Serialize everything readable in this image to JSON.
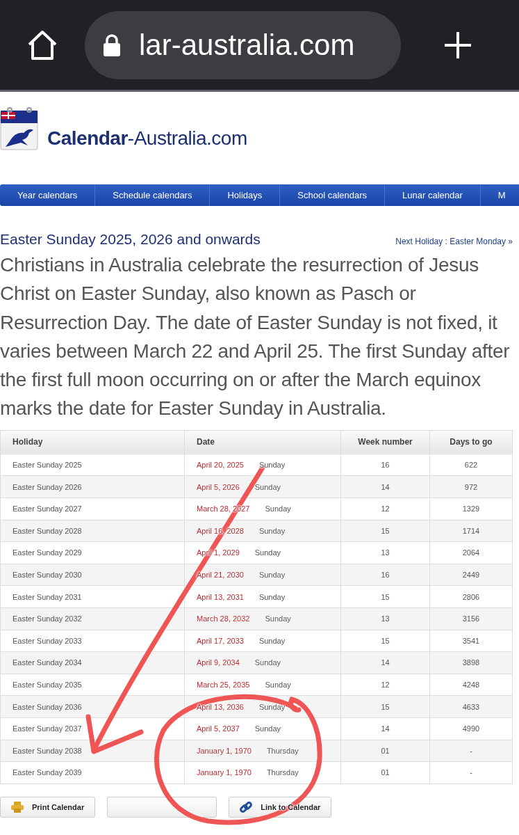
{
  "browser": {
    "url": "lar-australia.com"
  },
  "site": {
    "logo_text": "**Calendar**-Australia.com"
  },
  "nav": [
    {
      "label": "Year calendars"
    },
    {
      "label": "Schedule calendars"
    },
    {
      "label": "Holidays"
    },
    {
      "label": "School calendars"
    },
    {
      "label": "Lunar calendar"
    },
    {
      "label": "M"
    }
  ],
  "page": {
    "title": "Easter Sunday 2025, 2026 and onwards",
    "next_holiday": "Next Holiday : Easter Monday »",
    "intro": "Christians in Australia celebrate the resurrection of Jesus Christ on Easter Sunday, also known as Pasch or Resurrection Day. The date of Easter Sunday is not fixed, it varies between March 22 and April 25. The first Sunday after the first full moon occurring on or after the March equinox marks the date for Easter Sunday in Australia."
  },
  "table": {
    "columns": [
      "Holiday",
      "Date",
      "Week number",
      "Days to go"
    ],
    "rows": [
      {
        "holiday": "Easter Sunday 2025",
        "date": "April 20, 2025",
        "weekday": "Sunday",
        "week": "16",
        "days": "622"
      },
      {
        "holiday": "Easter Sunday 2026",
        "date": "April 5, 2026",
        "weekday": "Sunday",
        "week": "14",
        "days": "972"
      },
      {
        "holiday": "Easter Sunday 2027",
        "date": "March 28, 2027",
        "weekday": "Sunday",
        "week": "12",
        "days": "1329"
      },
      {
        "holiday": "Easter Sunday 2028",
        "date": "April 16, 2028",
        "weekday": "Sunday",
        "week": "15",
        "days": "1714"
      },
      {
        "holiday": "Easter Sunday 2029",
        "date": "April 1, 2029",
        "weekday": "Sunday",
        "week": "13",
        "days": "2064"
      },
      {
        "holiday": "Easter Sunday 2030",
        "date": "April 21, 2030",
        "weekday": "Sunday",
        "week": "16",
        "days": "2449"
      },
      {
        "holiday": "Easter Sunday 2031",
        "date": "April 13, 2031",
        "weekday": "Sunday",
        "week": "15",
        "days": "2806"
      },
      {
        "holiday": "Easter Sunday 2032",
        "date": "March 28, 2032",
        "weekday": "Sunday",
        "week": "13",
        "days": "3156"
      },
      {
        "holiday": "Easter Sunday 2033",
        "date": "April 17, 2033",
        "weekday": "Sunday",
        "week": "15",
        "days": "3541"
      },
      {
        "holiday": "Easter Sunday 2034",
        "date": "April 9, 2034",
        "weekday": "Sunday",
        "week": "14",
        "days": "3898"
      },
      {
        "holiday": "Easter Sunday 2035",
        "date": "March 25, 2035",
        "weekday": "Sunday",
        "week": "12",
        "days": "4248"
      },
      {
        "holiday": "Easter Sunday 2036",
        "date": "April 13, 2036",
        "weekday": "Sunday",
        "week": "15",
        "days": "4633"
      },
      {
        "holiday": "Easter Sunday 2037",
        "date": "April 5, 2037",
        "weekday": "Sunday",
        "week": "14",
        "days": "4990"
      },
      {
        "holiday": "Easter Sunday 2038",
        "date": "January 1, 1970",
        "weekday": "Thursday",
        "week": "01",
        "days": "-"
      },
      {
        "holiday": "Easter Sunday 2039",
        "date": "January 1, 1970",
        "weekday": "Thursday",
        "week": "01",
        "days": "-"
      }
    ]
  },
  "buttons": [
    {
      "kind": "print",
      "label": "Print Calendar"
    },
    {
      "kind": "blank"
    },
    {
      "kind": "link",
      "label": "Link to Calendar"
    }
  ],
  "annotations": {
    "arrow": true,
    "circle": true
  }
}
